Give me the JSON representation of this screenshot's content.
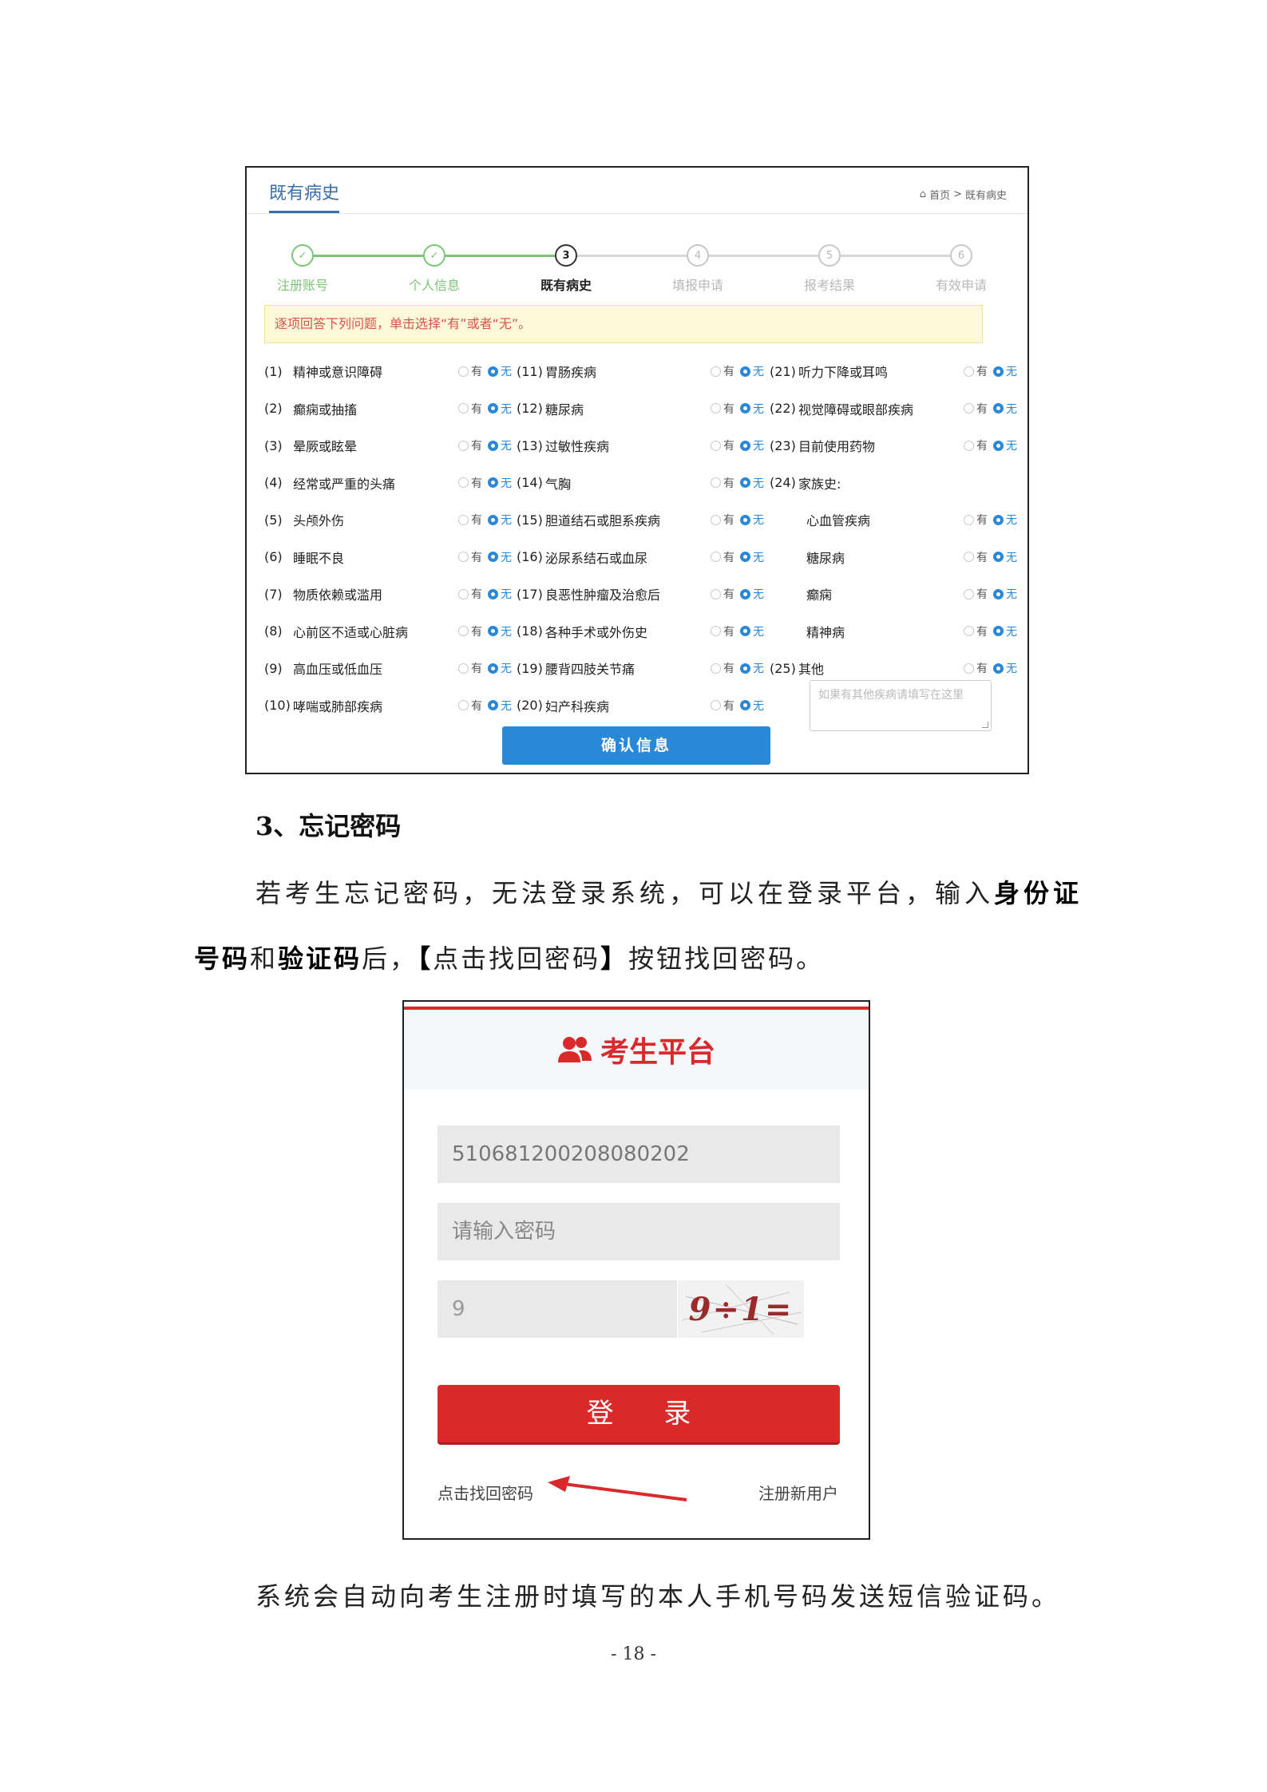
{
  "medical_history": {
    "title": "既有病史",
    "breadcrumb": {
      "home": "首页",
      "separator": ">",
      "current": "既有病史"
    },
    "steps": [
      {
        "num": "1",
        "label": "注册账号",
        "state": "done"
      },
      {
        "num": "2",
        "label": "个人信息",
        "state": "done"
      },
      {
        "num": "3",
        "label": "既有病史",
        "state": "current"
      },
      {
        "num": "4",
        "label": "填报申请",
        "state": "todo"
      },
      {
        "num": "5",
        "label": "报考结果",
        "state": "todo"
      },
      {
        "num": "6",
        "label": "有效申请",
        "state": "todo"
      }
    ],
    "notice": "逐项回答下列问题，单击选择“有”或者“无”。",
    "option_yes": "有",
    "option_no": "无",
    "columns": [
      [
        {
          "num": "(1)",
          "text": "精神或意识障碍",
          "answer": "无"
        },
        {
          "num": "(2)",
          "text": "癫痫或抽搐",
          "answer": "无"
        },
        {
          "num": "(3)",
          "text": "晕厥或眩晕",
          "answer": "无"
        },
        {
          "num": "(4)",
          "text": "经常或严重的头痛",
          "answer": "无"
        },
        {
          "num": "(5)",
          "text": "头颅外伤",
          "answer": "无"
        },
        {
          "num": "(6)",
          "text": "睡眠不良",
          "answer": "无"
        },
        {
          "num": "(7)",
          "text": "物质依赖或滥用",
          "answer": "无"
        },
        {
          "num": "(8)",
          "text": "心前区不适或心脏病",
          "answer": "无"
        },
        {
          "num": "(9)",
          "text": "高血压或低血压",
          "answer": "无"
        },
        {
          "num": "(10)",
          "text": "哮喘或肺部疾病",
          "answer": "无"
        }
      ],
      [
        {
          "num": "(11)",
          "text": "胃肠疾病",
          "answer": "无"
        },
        {
          "num": "(12)",
          "text": "糖尿病",
          "answer": "无"
        },
        {
          "num": "(13)",
          "text": "过敏性疾病",
          "answer": "无"
        },
        {
          "num": "(14)",
          "text": "气胸",
          "answer": "无"
        },
        {
          "num": "(15)",
          "text": "胆道结石或胆系疾病",
          "answer": "无"
        },
        {
          "num": "(16)",
          "text": "泌尿系结石或血尿",
          "answer": "无"
        },
        {
          "num": "(17)",
          "text": "良恶性肿瘤及治愈后",
          "answer": "无"
        },
        {
          "num": "(18)",
          "text": "各种手术或外伤史",
          "answer": "无"
        },
        {
          "num": "(19)",
          "text": "腰背四肢关节痛",
          "answer": "无"
        },
        {
          "num": "(20)",
          "text": "妇产科疾病",
          "answer": "无"
        }
      ],
      [
        {
          "num": "(21)",
          "text": "听力下降或耳鸣",
          "answer": "无"
        },
        {
          "num": "(22)",
          "text": "视觉障碍或眼部疾病",
          "answer": "无"
        },
        {
          "num": "(23)",
          "text": "目前使用药物",
          "answer": "无"
        },
        {
          "num": "(24)",
          "text": "家族史:",
          "answer": null
        },
        {
          "num": "",
          "text": "心血管疾病",
          "answer": "无"
        },
        {
          "num": "",
          "text": "糖尿病",
          "answer": "无"
        },
        {
          "num": "",
          "text": "癫痫",
          "answer": "无"
        },
        {
          "num": "",
          "text": "精神病",
          "answer": "无"
        },
        {
          "num": "(25)",
          "text": "其他",
          "answer": "无"
        }
      ]
    ],
    "other_placeholder": "如果有其他疾病请填写在这里",
    "confirm_label": "确认信息"
  },
  "document": {
    "section_heading": "3、忘记密码",
    "para1": {
      "before": "若考生忘记密码，无法登录系统，可以在登录平台，输入",
      "bold1": "身份证"
    },
    "para2": {
      "bold1": "号码",
      "mid1": "和",
      "bold2": "验证码",
      "mid2": "后，",
      "bracket_open": "【",
      "action": "点击找回密码",
      "bracket_close": "】",
      "after": "按钮找回密码。"
    },
    "para3": "系统会自动向考生注册时填写的本人手机号码发送短信验证码。",
    "page_number": "- 18 -"
  },
  "login": {
    "title": "考生平台",
    "id_value": "510681200208080202",
    "password_placeholder": "请输入密码",
    "captcha_value": "9",
    "captcha_code": "9÷1=",
    "login_label": "登 录",
    "forgot_link": "点击找回密码",
    "register_link": "注册新用户",
    "accent_color": "#d9292b"
  }
}
